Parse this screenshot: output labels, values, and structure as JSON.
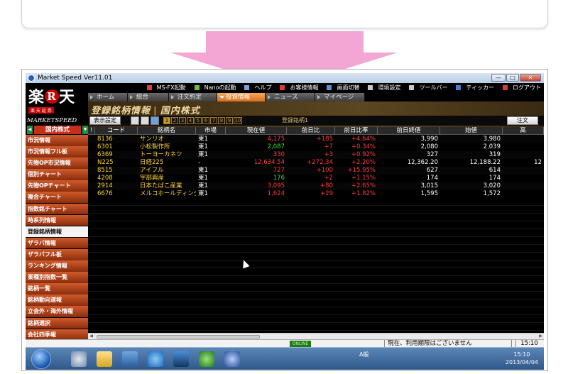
{
  "window": {
    "title": "Market Speed Ver11.01",
    "buttons": [
      "—",
      "□",
      "✕"
    ]
  },
  "logo": {
    "main": "楽",
    "mark": "R",
    "main2": "天",
    "sub": "楽 天 証 券",
    "product": "MARKETSPEED",
    "market_select": "国内株式"
  },
  "toolbar": {
    "items": [
      {
        "label": "MS-FX起動",
        "color": "#e23b3b"
      },
      {
        "label": "Nanoの起動",
        "color": "#6fbf3a"
      },
      {
        "label": "ヘルプ",
        "color": "#7f9fd8"
      },
      {
        "label": "お客様情報",
        "color": "#d63c3c"
      },
      {
        "label": "画面切替",
        "color": "#5d8fd6"
      },
      {
        "label": "環境設定",
        "color": "#c8c8c8"
      },
      {
        "label": "ツールバー",
        "color": "#c8c8c8"
      },
      {
        "label": "ティッカー",
        "color": "#4f79c9"
      },
      {
        "label": "ログアウト",
        "color": "#d63c3c"
      }
    ]
  },
  "tabs": [
    {
      "label": "ホーム",
      "active": false
    },
    {
      "label": "総合",
      "active": false
    },
    {
      "label": "注文約定",
      "active": false
    },
    {
      "label": "投資情報",
      "active": true
    },
    {
      "label": "ニュース",
      "active": false
    },
    {
      "label": "マイページ",
      "active": false
    }
  ],
  "page": {
    "title": "登録銘柄情報",
    "section": "国内株式"
  },
  "controls": {
    "settings": "表示設定",
    "pages": [
      "1",
      "2",
      "3",
      "4",
      "5",
      "6",
      "7",
      "8",
      "9",
      "10"
    ],
    "current_page": "1",
    "register_label": "登録銘柄1",
    "order": "注文"
  },
  "sidebar": [
    {
      "label": "市況情報",
      "active": false
    },
    {
      "label": "市況情報フル板",
      "active": false
    },
    {
      "label": "先物OP市況情報",
      "active": false
    },
    {
      "label": "個別チャート",
      "active": false
    },
    {
      "label": "先物OPチャート",
      "active": false
    },
    {
      "label": "複合チャート",
      "active": false
    },
    {
      "label": "指数銘チャート",
      "active": false
    },
    {
      "label": "時系列情報",
      "active": false
    },
    {
      "label": "登録銘柄情報",
      "active": true
    },
    {
      "label": "ザラバ情報",
      "active": false
    },
    {
      "label": "ザラバフル板",
      "active": false
    },
    {
      "label": "ランキング情報",
      "active": false
    },
    {
      "label": "業種別指数一覧",
      "active": false
    },
    {
      "label": "銘柄一覧",
      "active": false
    },
    {
      "label": "銘柄動向速報",
      "active": false
    },
    {
      "label": "立会外・海外情報",
      "active": false
    },
    {
      "label": "銘柄選択",
      "active": false
    },
    {
      "label": "会社四季報",
      "active": false
    }
  ],
  "table": {
    "headers": [
      "!",
      "コード",
      "銘柄名",
      "市場",
      "現在値",
      "前日比",
      "前日比率",
      "前日終値",
      "始値",
      "高"
    ],
    "rows": [
      [
        "",
        "8136",
        "サンリオ",
        "東1",
        "4,175",
        "+185",
        "+4.64%",
        "3,990",
        "3,980",
        ""
      ],
      [
        "",
        "6301",
        "小松製作所",
        "東1",
        "2,087",
        "+7",
        "+0.34%",
        "2,080",
        "2,039",
        ""
      ],
      [
        "",
        "6369",
        "トーヨーカネツ",
        "東1",
        "330",
        "+3",
        "+0.92%",
        "327",
        "319",
        ""
      ],
      [
        "",
        "N225",
        "日経225",
        "-",
        "12,634.54",
        "+272.34",
        "+2.20%",
        "12,362.20",
        "12,188.22",
        "12"
      ],
      [
        "",
        "8515",
        "アイフル",
        "東1",
        "727",
        "+100",
        "+15.95%",
        "627",
        "614",
        ""
      ],
      [
        "",
        "4208",
        "宇部興産",
        "東1",
        "176",
        "+2",
        "+1.15%",
        "174",
        "174",
        ""
      ],
      [
        "",
        "2914",
        "日本たばこ産業",
        "東1",
        "3,095",
        "+80",
        "+2.65%",
        "3,015",
        "3,020",
        ""
      ],
      [
        "",
        "6676",
        "メルコホールディング",
        "東1",
        "1,624",
        "+29",
        "+1.82%",
        "1,595",
        "1,572",
        ""
      ]
    ],
    "price_colors": [
      "#ff3b3b",
      "#3de03d",
      "#ff3b3b",
      "#ff3b3b",
      "#ff3b3b",
      "#3de03d",
      "#ff3b3b",
      "#ff3b3b"
    ]
  },
  "status": {
    "online": "ONLINE",
    "message": "現在、利用期限はございません",
    "time": "15:10"
  },
  "taskbar": {
    "tray": "A般",
    "clock_time": "15:10",
    "clock_date": "2013/04/04"
  },
  "colors": {
    "accent_orange": "#e07a28",
    "rise_red": "#ff3b3b",
    "code_yellow": "#ffd23a"
  }
}
